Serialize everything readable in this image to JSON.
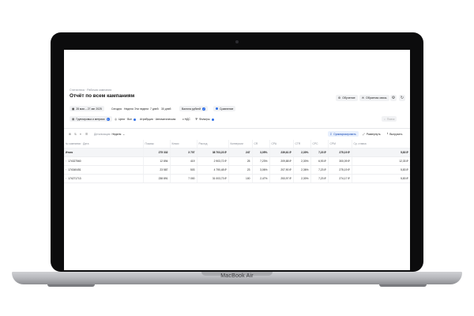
{
  "laptop": {
    "model": "MacBook Air"
  },
  "header": {
    "breadcrumb": "Статистика · Рабочая кампания",
    "title": "Отчёт по всем кампаниям",
    "actions": [
      {
        "label": "Обучение",
        "icon": "graduation-icon"
      },
      {
        "label": "Обратная связь",
        "icon": "chat-icon"
      }
    ],
    "icon_buttons": [
      "gear-icon",
      "refresh-icon"
    ]
  },
  "filters_row1": {
    "date_range": "28 мая – 27 авг 2025",
    "group_label": "Сегодня",
    "period": "Неделя",
    "prev_label": "Эти недели",
    "granularity": "7 дней",
    "days": "30 дней",
    "currency": "Валюта рублей",
    "compare": "Сравнение"
  },
  "filters_row2": {
    "group_by": "Группировка и метрики",
    "goals": "Цели · Все",
    "attribution": "Атрибуция · Автоматическая",
    "vat": "с НДС",
    "filters": "Фильтры",
    "search_placeholder": "Поиск"
  },
  "toolbar": {
    "detail_label": "Детализация",
    "detail_value": "Неделя",
    "summarize": "Суммаризировать",
    "expand": "Развернуть",
    "export": "Выгрузить"
  },
  "table": {
    "columns": [
      "№ кампании · Дата",
      "Показы",
      "Клики",
      "Расход",
      "Конверсии",
      "CR",
      "CPA",
      "CTR",
      "CPC",
      "CPM",
      "Ср. ставка"
    ],
    "total": [
      "Итого",
      "275 332",
      "3 707",
      "38 703,23 ₽",
      "247",
      "3,05%",
      "239,61 ₽",
      "2,30%",
      "7,23 ₽",
      "275,19 ₽",
      "5,83 ₽"
    ],
    "rows": [
      [
        "174327560",
        "12 894",
        "419",
        "2 903,72 ₽",
        "25",
        "7,23%",
        "209,88 ₽",
        "2,30%",
        "6,93 ₽",
        "300,09 ₽",
        "12,33 ₽"
      ],
      [
        "174340451",
        "23 587",
        "503",
        "4 790,48 ₽",
        "23",
        "3,06%",
        "207,90 ₽",
        "2,36%",
        "7,23 ₽",
        "275,19 ₽",
        "5,83 ₽"
      ],
      [
        "174271713",
        "238 891",
        "7 000",
        "31 003,73 ₽",
        "100",
        "2,47%",
        "253,97 ₽",
        "2,30%",
        "7,23 ₽",
        "274,17 ₽",
        "5,83 ₽"
      ]
    ]
  }
}
